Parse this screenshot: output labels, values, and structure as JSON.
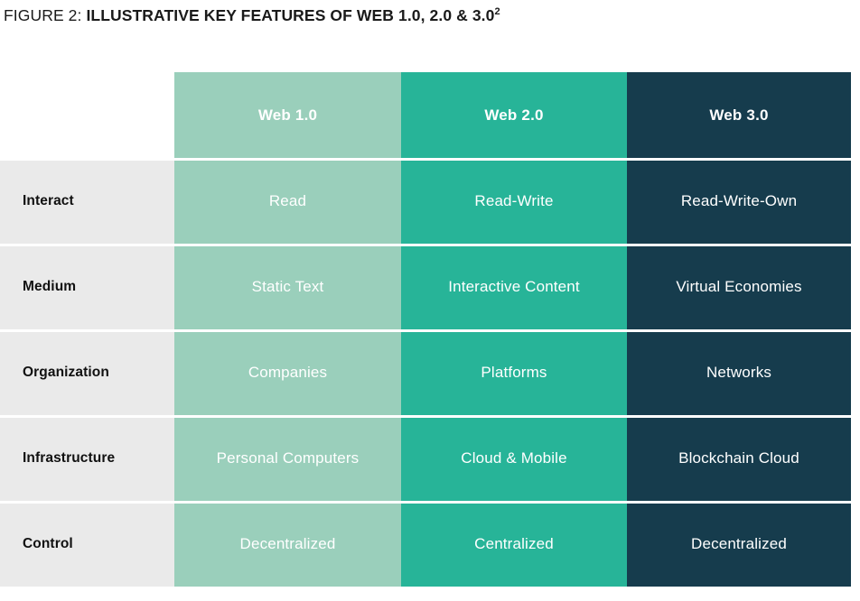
{
  "figure": {
    "label": "FIGURE 2:",
    "title": "ILLUSTRATIVE KEY FEATURES OF WEB 1.0, 2.0 & 3.0",
    "footnote_marker": "2"
  },
  "colors": {
    "web1": "#9acfbb",
    "web2": "#27b498",
    "web3": "#163c4d",
    "row_label_bg": "#eaeaea",
    "page_bg": "#ffffff",
    "title_text": "#1a1a1a",
    "cell_text": "#ffffff",
    "label_text": "#111111",
    "separator": "#ffffff"
  },
  "table": {
    "corner_label": "",
    "columns": [
      {
        "key": "web1",
        "label": "Web 1.0"
      },
      {
        "key": "web2",
        "label": "Web 2.0"
      },
      {
        "key": "web3",
        "label": "Web 3.0"
      }
    ],
    "rows": [
      {
        "label": "Interact",
        "cells": [
          "Read",
          "Read-Write",
          "Read-Write-Own"
        ]
      },
      {
        "label": "Medium",
        "cells": [
          "Static Text",
          "Interactive Content",
          "Virtual Economies"
        ]
      },
      {
        "label": "Organization",
        "cells": [
          "Companies",
          "Platforms",
          "Networks"
        ]
      },
      {
        "label": "Infrastructure",
        "cells": [
          "Personal Computers",
          "Cloud & Mobile",
          "Blockchain Cloud"
        ]
      },
      {
        "label": "Control",
        "cells": [
          "Decentralized",
          "Centralized",
          "Decentralized"
        ]
      }
    ]
  },
  "chart_data": {
    "type": "table",
    "title": "FIGURE 2: ILLUSTRATIVE KEY FEATURES OF WEB 1.0, 2.0 & 3.0",
    "categories": [
      "Web 1.0",
      "Web 2.0",
      "Web 3.0"
    ],
    "row_headers": [
      "Interact",
      "Medium",
      "Organization",
      "Infrastructure",
      "Control"
    ],
    "values": [
      [
        "Read",
        "Read-Write",
        "Read-Write-Own"
      ],
      [
        "Static Text",
        "Interactive Content",
        "Virtual Economies"
      ],
      [
        "Companies",
        "Platforms",
        "Networks"
      ],
      [
        "Personal Computers",
        "Cloud & Mobile",
        "Blockchain Cloud"
      ],
      [
        "Decentralized",
        "Centralized",
        "Decentralized"
      ]
    ],
    "series": [
      {
        "name": "Web 1.0",
        "values": [
          "Read",
          "Static Text",
          "Companies",
          "Personal Computers",
          "Decentralized"
        ]
      },
      {
        "name": "Web 2.0",
        "values": [
          "Read-Write",
          "Interactive Content",
          "Platforms",
          "Cloud & Mobile",
          "Centralized"
        ]
      },
      {
        "name": "Web 3.0",
        "values": [
          "Read-Write-Own",
          "Virtual Economies",
          "Networks",
          "Blockchain Cloud",
          "Decentralized"
        ]
      }
    ],
    "xlabel": "",
    "ylabel": "",
    "legend": false,
    "grid": true
  }
}
